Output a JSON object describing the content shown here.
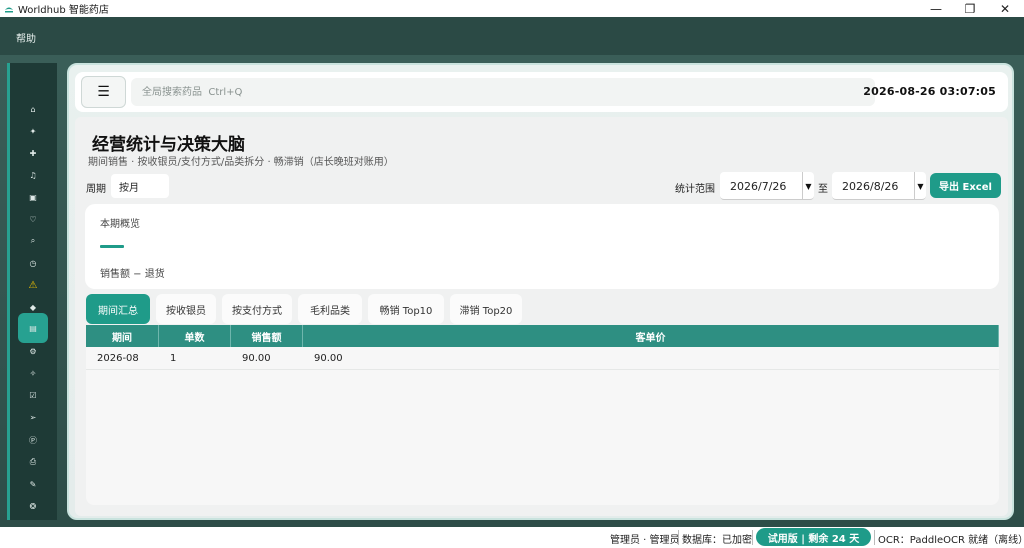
{
  "window": {
    "title": "Worldhub 智能药店",
    "minimize": "—",
    "maximize": "❐",
    "close": "✕"
  },
  "menubar": {
    "items": [
      {
        "label": "帮助"
      }
    ]
  },
  "sidebar": {
    "icons": [
      {
        "name": "home-icon",
        "glyph": "⌂"
      },
      {
        "name": "sparkle-icon",
        "glyph": "✦"
      },
      {
        "name": "plus-icon",
        "glyph": "✚"
      },
      {
        "name": "bell-icon",
        "glyph": "♫"
      },
      {
        "name": "document-icon",
        "glyph": "▣"
      },
      {
        "name": "heart-icon",
        "glyph": "♡"
      },
      {
        "name": "search-icon",
        "glyph": "⌕"
      },
      {
        "name": "clock-icon",
        "glyph": "◷"
      },
      {
        "name": "warning-icon",
        "glyph": "⚠"
      },
      {
        "name": "pin-icon",
        "glyph": "◆"
      },
      {
        "name": "stats-icon",
        "glyph": "▤"
      },
      {
        "name": "gear-icon",
        "glyph": "⚙"
      },
      {
        "name": "star-icon",
        "glyph": "✧"
      },
      {
        "name": "edit-icon",
        "glyph": "☑"
      },
      {
        "name": "send-icon",
        "glyph": "➢"
      },
      {
        "name": "coin-icon",
        "glyph": "Ⓟ"
      },
      {
        "name": "printer-icon",
        "glyph": "⎙"
      },
      {
        "name": "pill-icon",
        "glyph": "✎"
      },
      {
        "name": "settings-icon",
        "glyph": "❂"
      }
    ],
    "active_index": 10
  },
  "topbar": {
    "menu_glyph": "☰",
    "search_placeholder": "全局搜索药品  Ctrl+Q",
    "datetime": "2026-08-26  03:07:05"
  },
  "page": {
    "title": "经营统计与决策大脑",
    "subtitle": "期间销售 · 按收银员/支付方式/品类拆分 · 畅滞销（店长晚班对账用）",
    "period_label": "周期",
    "period_value": "按月",
    "range_label": "统计范围",
    "date_from": "2026/7/26",
    "to_label": "至",
    "date_to": "2026/8/26",
    "dropdown_glyph": "▼",
    "export_label": "导出 Excel"
  },
  "overview": {
    "title": "本期概览",
    "caption": "销售额 − 退货"
  },
  "tabs": [
    {
      "label": "期间汇总",
      "active": true
    },
    {
      "label": "按收银员",
      "active": false
    },
    {
      "label": "按支付方式",
      "active": false
    },
    {
      "label": "毛利品类",
      "active": false
    },
    {
      "label": "畅销 Top10",
      "active": false
    },
    {
      "label": "滞销 Top20",
      "active": false
    }
  ],
  "table": {
    "columns": [
      "期间",
      "单数",
      "销售额",
      "客单价"
    ],
    "rows": [
      [
        "2026-08",
        "1",
        "90.00",
        "90.00"
      ]
    ]
  },
  "statusbar": {
    "user": "管理员 · 管理员",
    "database": "数据库：已加密",
    "trial": "试用版 | 剩余 24 天",
    "ocr": "OCR：PaddleOCR 就绪（离线）"
  },
  "colors": {
    "accent": "#1f9b89",
    "menubar": "#2b4a45",
    "sidebar": "#1e3a36",
    "table_header": "#2e8f82"
  }
}
